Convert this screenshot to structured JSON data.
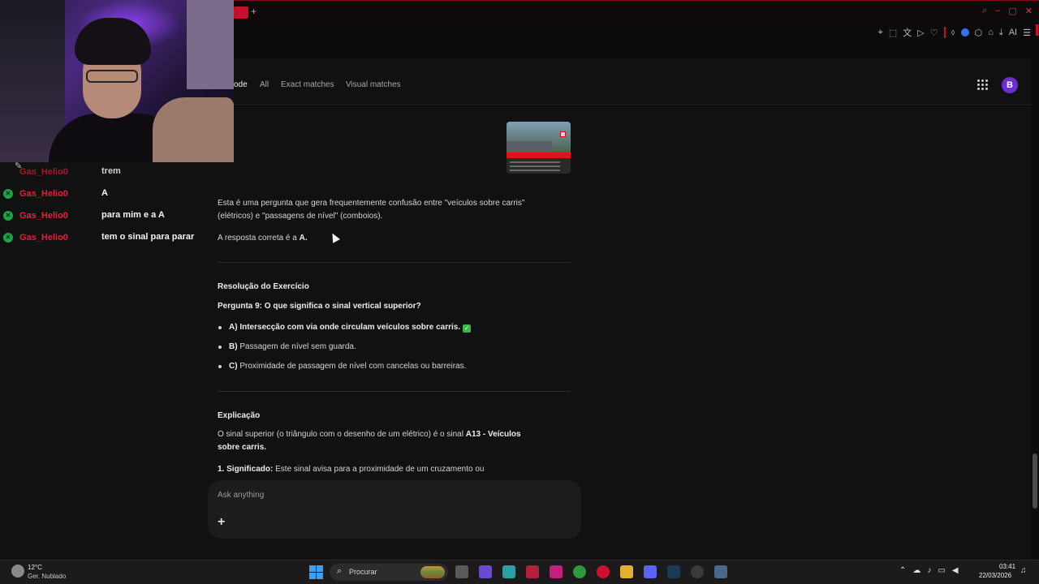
{
  "lens": {
    "tabs": [
      {
        "label": "ode",
        "active": true
      },
      {
        "label": "All",
        "active": false
      },
      {
        "label": "Exact matches",
        "active": false
      },
      {
        "label": "Visual matches",
        "active": false
      }
    ],
    "avatar_initial": "B",
    "apps_icon": "apps-grid-icon"
  },
  "answer": {
    "intro_line1": "Esta é uma pergunta que gera frequentemente confusão entre \"veículos sobre carris\"",
    "intro_line2": "(elétricos) e \"passagens de nível\" (comboios).",
    "correct_prefix": "A resposta correta é a ",
    "correct_letter": "A.",
    "resolution_heading": "Resolução do Exercício",
    "question": "Pergunta 9: O que significa o sinal vertical superior?",
    "options": [
      {
        "letter": "A)",
        "text": "Intersecção com via onde circulam veículos sobre carris.",
        "bold": true,
        "correct": true
      },
      {
        "letter": "B)",
        "text": "Passagem de nível sem guarda.",
        "bold": false,
        "correct": false
      },
      {
        "letter": "C)",
        "text": "Proximidade de passagem de nível com cancelas ou barreiras.",
        "bold": false,
        "correct": false
      }
    ],
    "explanation_heading": "Explicação",
    "explanation_line1_a": "O sinal superior (o triângulo com o desenho de um elétrico) é o sinal ",
    "explanation_line1_b": "A13 - Veículos",
    "explanation_line2": "sobre carris.",
    "point1_label": "1. Significado:",
    "point1_text": " Este sinal avisa para a proximidade de um cruzamento ou"
  },
  "ask": {
    "placeholder": "Ask anything",
    "plus": "+"
  },
  "chat": [
    {
      "user": "Gas_Helio0",
      "message": "trem"
    },
    {
      "user": "Gas_Helio0",
      "message": "A"
    },
    {
      "user": "Gas_Helio0",
      "message": "para mim e a A"
    },
    {
      "user": "Gas_Helio0",
      "message": "tem o sinal para parar"
    }
  ],
  "toolbar": {
    "ai_label": "AI"
  },
  "taskbar": {
    "temperature": "12°C",
    "weather": "Ger. Nublado",
    "search_label": "Procurar",
    "time": "03:41",
    "date": "22/03/2026"
  },
  "colors": {
    "accent_red": "#c4102c",
    "chat_user": "#e0203a",
    "check_green": "#3bb54a",
    "avatar": "#6b2fd1"
  }
}
